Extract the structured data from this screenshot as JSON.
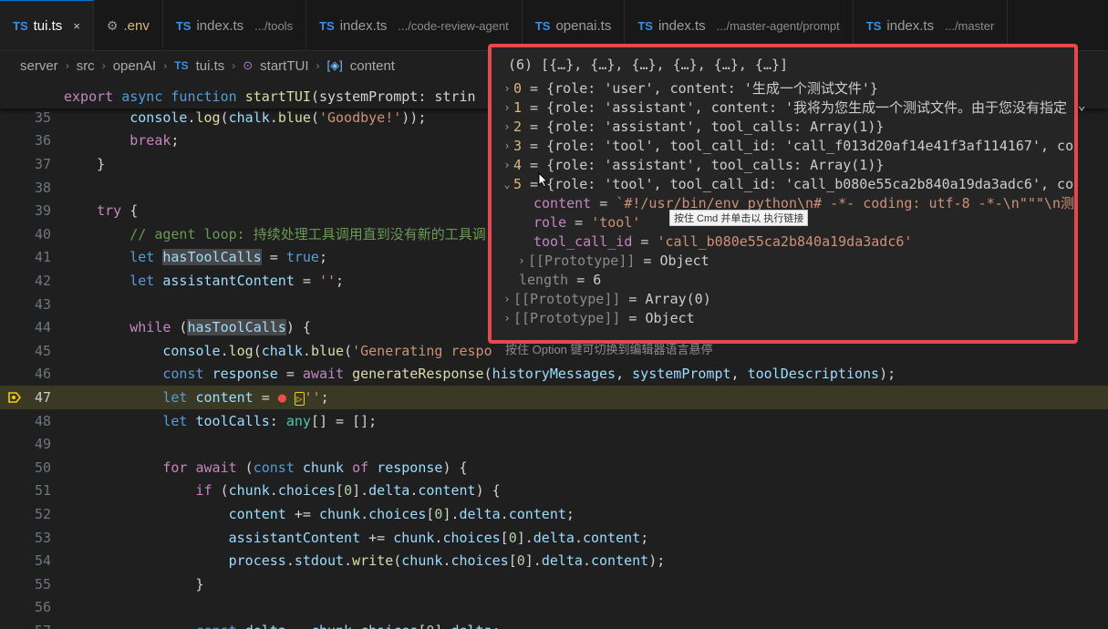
{
  "tabs": [
    {
      "prefix": "TS",
      "name": "tui.ts",
      "path": "",
      "close": "×"
    },
    {
      "prefix": "",
      "name": ".env",
      "path": ""
    },
    {
      "prefix": "TS",
      "name": "index.ts",
      "path": ".../tools"
    },
    {
      "prefix": "TS",
      "name": "index.ts",
      "path": ".../code-review-agent"
    },
    {
      "prefix": "TS",
      "name": "openai.ts",
      "path": ""
    },
    {
      "prefix": "TS",
      "name": "index.ts",
      "path": ".../master-agent/prompt"
    },
    {
      "prefix": "TS",
      "name": "index.ts",
      "path": ".../master"
    }
  ],
  "breadcrumb": {
    "items": [
      "server",
      "src",
      "openAI",
      "tui.ts",
      "startTUI",
      "content"
    ],
    "ts_prefix": "TS"
  },
  "editor": {
    "sticky": {
      "kw1": "export",
      "kw2": "async",
      "kw3": "function",
      "fn": "startTUI",
      "rest": "(systemPrompt: strin"
    },
    "lines": [
      {
        "n": "35",
        "indent": "    ",
        "text": "console.log(chalk.blue('Goodbye!'));"
      },
      {
        "n": "36",
        "indent": "    ",
        "text": "break;"
      },
      {
        "n": "37",
        "indent": "  ",
        "text": "}"
      },
      {
        "n": "38",
        "indent": "",
        "text": ""
      },
      {
        "n": "39",
        "indent": "  ",
        "text": "try {"
      },
      {
        "n": "40",
        "indent": "    ",
        "text": "// agent loop: 持续处理工具调用直到没有新的工具调"
      },
      {
        "n": "41",
        "indent": "    ",
        "text": "let hasToolCalls = true;"
      },
      {
        "n": "42",
        "indent": "    ",
        "text": "let assistantContent = '';"
      },
      {
        "n": "43",
        "indent": "",
        "text": ""
      },
      {
        "n": "44",
        "indent": "    ",
        "text": "while (hasToolCalls) {"
      },
      {
        "n": "45",
        "indent": "      ",
        "text": "console.log(chalk.blue('Generating respo"
      },
      {
        "n": "46",
        "indent": "      ",
        "text": "const response = await generateResponse(historyMessages, systemPrompt, toolDescriptions);"
      },
      {
        "n": "47",
        "indent": "      ",
        "text": "let content = ''';"
      },
      {
        "n": "48",
        "indent": "      ",
        "text": "let toolCalls: any[] = [];"
      },
      {
        "n": "49",
        "indent": "",
        "text": ""
      },
      {
        "n": "50",
        "indent": "      ",
        "text": "for await (const chunk of response) {"
      },
      {
        "n": "51",
        "indent": "        ",
        "text": "if (chunk.choices[0].delta.content) {"
      },
      {
        "n": "52",
        "indent": "          ",
        "text": "content += chunk.choices[0].delta.content;"
      },
      {
        "n": "53",
        "indent": "          ",
        "text": "assistantContent += chunk.choices[0].delta.content;"
      },
      {
        "n": "54",
        "indent": "          ",
        "text": "process.stdout.write(chunk.choices[0].delta.content);"
      },
      {
        "n": "55",
        "indent": "        ",
        "text": "}"
      },
      {
        "n": "56",
        "indent": "",
        "text": ""
      },
      {
        "n": "57",
        "indent": "        ",
        "text": "const delta = chunk.choices[0].delta;"
      }
    ]
  },
  "hover": {
    "header": "(6) [{…}, {…}, {…}, {…}, {…}, {…}]",
    "items": [
      {
        "idx": "0",
        "text": "{role: 'user', content: '生成一个测试文件'}"
      },
      {
        "idx": "1",
        "text": "{role: 'assistant', content: '我将为您生成一个测试文件。由于您没有指定"
      },
      {
        "idx": "2",
        "text": "{role: 'assistant', tool_calls: Array(1)}"
      },
      {
        "idx": "3",
        "text": "{role: 'tool', tool_call_id: 'call_f013d20af14e41f3af114167', co"
      },
      {
        "idx": "4",
        "text": "{role: 'assistant', tool_calls: Array(1)}"
      },
      {
        "idx": "5",
        "text": "{role: 'tool', tool_call_id: 'call_b080e55ca2b840a19da3adc6', co"
      }
    ],
    "expanded": [
      {
        "key": "content",
        "eq": " = ",
        "val": "`#!/usr/bin/env python\\n# -*- coding: utf-8 -*-\\n\"\"\"\\n测"
      },
      {
        "key": "role",
        "eq": " = ",
        "val": "'tool'"
      },
      {
        "key": "tool_call_id",
        "eq": " = ",
        "val": "'call_b080e55ca2b840a19da3adc6'"
      }
    ],
    "proto_obj": "[[Prototype]]",
    "proto_obj_val": "Object",
    "length_key": "length",
    "length_val": "6",
    "proto_arr": "[[Prototype]]",
    "proto_arr_val": "Array(0)",
    "proto_root": "[[Prototype]]",
    "proto_root_val": "Object",
    "tooltip": "按住 Cmd 并单击以 执行链接",
    "status": "按住 Option 键可切换到编辑器语言悬停"
  },
  "colors": {
    "highlight_border": "#e5484d",
    "breakpoint": "#f14c4c",
    "debug_line": "#3a3a24"
  }
}
